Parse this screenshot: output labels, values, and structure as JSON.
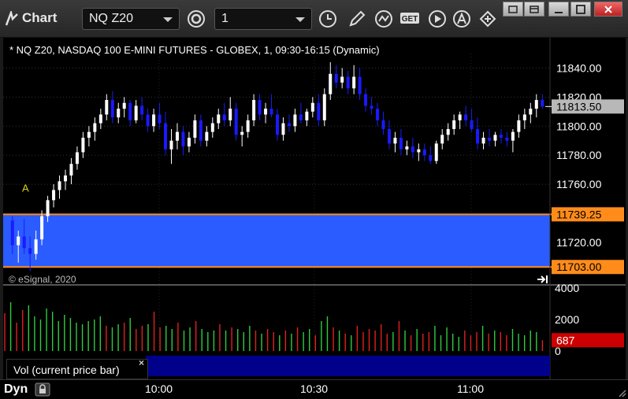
{
  "window": {
    "title": "Chart",
    "symbol_combo": "NQ Z20",
    "interval_combo": "1"
  },
  "toolbar": {
    "buttons": [
      "settings-icon",
      "clock-icon",
      "pencil-icon",
      "line-study-icon",
      "get-icon",
      "play-icon",
      "alert-icon",
      "link-icon"
    ],
    "get_label": "GET"
  },
  "chart": {
    "symbol_info": "* NQ Z20, NASDAQ 100 E-MINI FUTURES - GLOBEX, 1, 09:30-16:15 (Dynamic)",
    "copyright": "© eSignal, 2020",
    "marker_label": "A",
    "volume_label": "Vol (current price bar)",
    "volume_close": "×",
    "status_label": "Dyn",
    "colors": {
      "up": "#ffffff",
      "down": "#1a1aff",
      "zone_fill": "#2a5cff",
      "zone_border": "#ff8c1a",
      "vol_up": "#2ecc40",
      "vol_down": "#e02020",
      "current_price_bg": "#b8b8b8",
      "volume_badge_bg": "#cc0000"
    }
  },
  "chart_data": {
    "type": "candlestick",
    "price_axis": {
      "ticks": [
        "11840.00",
        "11820.00",
        "11800.00",
        "11780.00",
        "11760.00",
        "11720.00"
      ],
      "range": [
        11695,
        11850
      ]
    },
    "badges": {
      "current_price": "11813.50",
      "zone_top": "11739.25",
      "zone_bottom": "11703.00"
    },
    "zone": {
      "top": 11739.25,
      "bottom": 11703.0
    },
    "volume_axis": {
      "ticks": [
        "4000",
        "2000",
        "0"
      ],
      "range": [
        0,
        4000
      ],
      "current_volume": "687"
    },
    "time_axis": {
      "ticks": [
        "10:00",
        "10:30",
        "11:00"
      ]
    },
    "candles": [
      [
        11735,
        11738,
        11712,
        11718
      ],
      [
        11718,
        11728,
        11706,
        11724
      ],
      [
        11724,
        11736,
        11712,
        11716
      ],
      [
        11716,
        11724,
        11700,
        11712
      ],
      [
        11712,
        11728,
        11708,
        11722
      ],
      [
        11722,
        11742,
        11718,
        11738
      ],
      [
        11738,
        11752,
        11734,
        11749
      ],
      [
        11749,
        11760,
        11744,
        11756
      ],
      [
        11756,
        11766,
        11750,
        11762
      ],
      [
        11762,
        11770,
        11756,
        11766
      ],
      [
        11766,
        11778,
        11760,
        11774
      ],
      [
        11774,
        11786,
        11770,
        11782
      ],
      [
        11782,
        11796,
        11778,
        11792
      ],
      [
        11792,
        11800,
        11786,
        11796
      ],
      [
        11796,
        11806,
        11790,
        11802
      ],
      [
        11802,
        11812,
        11798,
        11808
      ],
      [
        11808,
        11822,
        11804,
        11818
      ],
      [
        11818,
        11824,
        11802,
        11806
      ],
      [
        11806,
        11816,
        11802,
        11812
      ],
      [
        11812,
        11820,
        11806,
        11816
      ],
      [
        11816,
        11818,
        11800,
        11804
      ],
      [
        11804,
        11818,
        11802,
        11814
      ],
      [
        11814,
        11820,
        11804,
        11808
      ],
      [
        11808,
        11812,
        11796,
        11800
      ],
      [
        11800,
        11812,
        11796,
        11808
      ],
      [
        11808,
        11816,
        11798,
        11802
      ],
      [
        11802,
        11810,
        11780,
        11784
      ],
      [
        11784,
        11798,
        11774,
        11790
      ],
      [
        11790,
        11802,
        11784,
        11796
      ],
      [
        11796,
        11800,
        11780,
        11786
      ],
      [
        11786,
        11796,
        11782,
        11792
      ],
      [
        11792,
        11808,
        11788,
        11804
      ],
      [
        11804,
        11808,
        11786,
        11790
      ],
      [
        11790,
        11800,
        11786,
        11796
      ],
      [
        11796,
        11806,
        11792,
        11802
      ],
      [
        11802,
        11812,
        11798,
        11808
      ],
      [
        11808,
        11816,
        11800,
        11804
      ],
      [
        11804,
        11820,
        11800,
        11812
      ],
      [
        11812,
        11816,
        11790,
        11794
      ],
      [
        11794,
        11800,
        11786,
        11796
      ],
      [
        11796,
        11808,
        11792,
        11804
      ],
      [
        11804,
        11822,
        11800,
        11818
      ],
      [
        11818,
        11822,
        11804,
        11808
      ],
      [
        11808,
        11816,
        11802,
        11812
      ],
      [
        11812,
        11822,
        11806,
        11808
      ],
      [
        11808,
        11812,
        11790,
        11794
      ],
      [
        11794,
        11806,
        11790,
        11802
      ],
      [
        11802,
        11808,
        11796,
        11800
      ],
      [
        11800,
        11812,
        11796,
        11808
      ],
      [
        11808,
        11816,
        11802,
        11804
      ],
      [
        11804,
        11812,
        11800,
        11810
      ],
      [
        11810,
        11820,
        11806,
        11816
      ],
      [
        11816,
        11822,
        11800,
        11804
      ],
      [
        11804,
        11826,
        11800,
        11822
      ],
      [
        11822,
        11844,
        11818,
        11836
      ],
      [
        11836,
        11842,
        11826,
        11830
      ],
      [
        11830,
        11840,
        11826,
        11834
      ],
      [
        11834,
        11838,
        11822,
        11826
      ],
      [
        11826,
        11842,
        11822,
        11834
      ],
      [
        11834,
        11840,
        11818,
        11822
      ],
      [
        11822,
        11826,
        11810,
        11814
      ],
      [
        11814,
        11820,
        11808,
        11812
      ],
      [
        11812,
        11816,
        11800,
        11804
      ],
      [
        11804,
        11810,
        11794,
        11798
      ],
      [
        11798,
        11804,
        11784,
        11788
      ],
      [
        11788,
        11796,
        11782,
        11792
      ],
      [
        11792,
        11798,
        11780,
        11784
      ],
      [
        11784,
        11790,
        11780,
        11786
      ],
      [
        11786,
        11792,
        11778,
        11782
      ],
      [
        11782,
        11788,
        11776,
        11784
      ],
      [
        11784,
        11788,
        11776,
        11780
      ],
      [
        11780,
        11786,
        11774,
        11776
      ],
      [
        11776,
        11790,
        11774,
        11788
      ],
      [
        11788,
        11798,
        11784,
        11794
      ],
      [
        11794,
        11802,
        11790,
        11798
      ],
      [
        11798,
        11808,
        11794,
        11804
      ],
      [
        11804,
        11810,
        11798,
        11808
      ],
      [
        11808,
        11814,
        11800,
        11804
      ],
      [
        11804,
        11812,
        11796,
        11798
      ],
      [
        11798,
        11806,
        11784,
        11788
      ],
      [
        11788,
        11796,
        11784,
        11792
      ],
      [
        11792,
        11798,
        11786,
        11790
      ],
      [
        11790,
        11796,
        11786,
        11794
      ],
      [
        11794,
        11798,
        11788,
        11792
      ],
      [
        11792,
        11796,
        11786,
        11790
      ],
      [
        11790,
        11798,
        11782,
        11796
      ],
      [
        11796,
        11808,
        11792,
        11804
      ],
      [
        11804,
        11812,
        11798,
        11808
      ],
      [
        11808,
        11816,
        11802,
        11812
      ],
      [
        11812,
        11822,
        11806,
        11818
      ],
      [
        11818,
        11822,
        11812,
        11813.5
      ]
    ],
    "volumes": [
      2400,
      3100,
      1800,
      2600,
      2900,
      2200,
      2000,
      2700,
      2500,
      1900,
      2300,
      2100,
      1800,
      1700,
      1900,
      2000,
      2200,
      1600,
      1500,
      1700,
      1800,
      2100,
      1400,
      1600,
      1700,
      2500,
      1500,
      1600,
      1400,
      1800,
      1300,
      1500,
      1900,
      1400,
      1200,
      1300,
      1700,
      1300,
      1500,
      1400,
      1200,
      1600,
      1300,
      1100,
      1400,
      1200,
      1000,
      1300,
      1100,
      1500,
      1200,
      1400,
      1000,
      1900,
      2200,
      1500,
      1300,
      1100,
      1000,
      1600,
      1200,
      1400,
      1300,
      1700,
      1100,
      1200,
      1900,
      1300,
      1000,
      1400,
      1100,
      1200,
      1600,
      1000,
      1500,
      1100,
      900,
      1300,
      1000,
      1200,
      1600,
      1100,
      1300,
      1200,
      1000,
      1400,
      1100,
      1000,
      1300,
      1200,
      687
    ]
  }
}
